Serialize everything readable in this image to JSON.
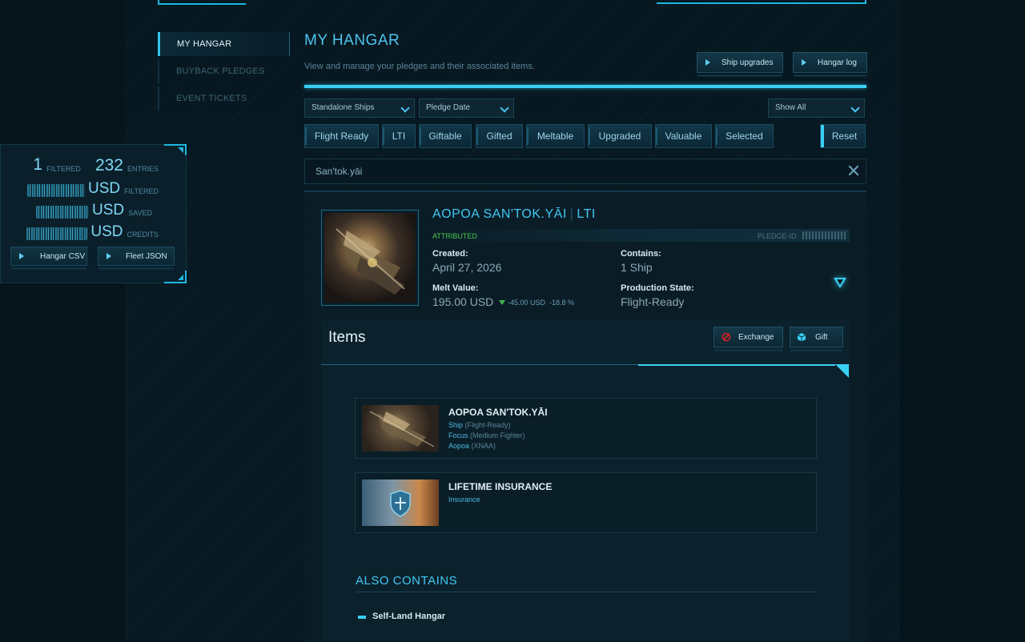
{
  "sidebar": {
    "items": [
      {
        "label": "MY HANGAR"
      },
      {
        "label": "BUYBACK PLEDGES"
      },
      {
        "label": "EVENT TICKETS"
      }
    ]
  },
  "stats": {
    "filtered_count": "1",
    "filtered_label": "FILTERED",
    "entries_count": "232",
    "entries_label": "ENTRIES",
    "currency": "USD",
    "usd_filtered_label": "FILTERED",
    "usd_saved_label": "SAVED",
    "usd_credits_label": "CREDITS",
    "hangar_csv": "Hangar CSV",
    "fleet_json": "Fleet JSON"
  },
  "header": {
    "title": "MY HANGAR",
    "subtitle": "View and manage your pledges and their associated items.",
    "ship_upgrades": "Ship upgrades",
    "hangar_log": "Hangar log"
  },
  "filters": {
    "type_select": "Standalone Ships",
    "sort_select": "Pledge Date",
    "show_select": "Show All",
    "chips": [
      "Flight Ready",
      "LTI",
      "Giftable",
      "Gifted",
      "Meltable",
      "Upgraded",
      "Valuable",
      "Selected"
    ],
    "reset": "Reset"
  },
  "search": {
    "value": "San'tok.yāi"
  },
  "pledge": {
    "name": "AOPOA SAN'TOK.YĀI",
    "tag": "LTI",
    "status": "ATTRIBUTED",
    "pledge_id_label": "PLEDGE-ID",
    "created_label": "Created:",
    "created": "April 27, 2026",
    "contains_label": "Contains:",
    "contains": "1 Ship",
    "melt_label": "Melt Value:",
    "melt": "195.00 USD",
    "melt_delta": "-45.00 USD",
    "melt_percent": "-18.8 %",
    "production_label": "Production State:",
    "production": "Flight-Ready"
  },
  "items": {
    "title": "Items",
    "exchange": "Exchange",
    "gift": "Gift",
    "list": [
      {
        "name": "AOPOA SAN'TOK.YĀI",
        "lines": [
          {
            "main": "Ship",
            "paren": "(Flight-Ready)"
          },
          {
            "main": "Focus",
            "paren": "(Medium Fighter)"
          },
          {
            "main": "Aopoa",
            "paren": "(XNAA)"
          }
        ]
      },
      {
        "name": "LIFETIME INSURANCE",
        "lines": [
          {
            "main": "Insurance",
            "paren": ""
          }
        ]
      }
    ]
  },
  "also_contains": {
    "title": "ALSO CONTAINS",
    "items": [
      "Self-Land Hangar"
    ]
  },
  "colors": {
    "accent": "#3ad0f5",
    "title": "#41c8f3",
    "attributed": "#4cc84c",
    "down_arrow": "#3fb84c",
    "exchange_icon": "#e02020"
  },
  "icons": [
    "play-icon",
    "chevron-down-icon",
    "close-icon",
    "expand-triangle-icon",
    "exchange-icon",
    "gift-icon"
  ]
}
